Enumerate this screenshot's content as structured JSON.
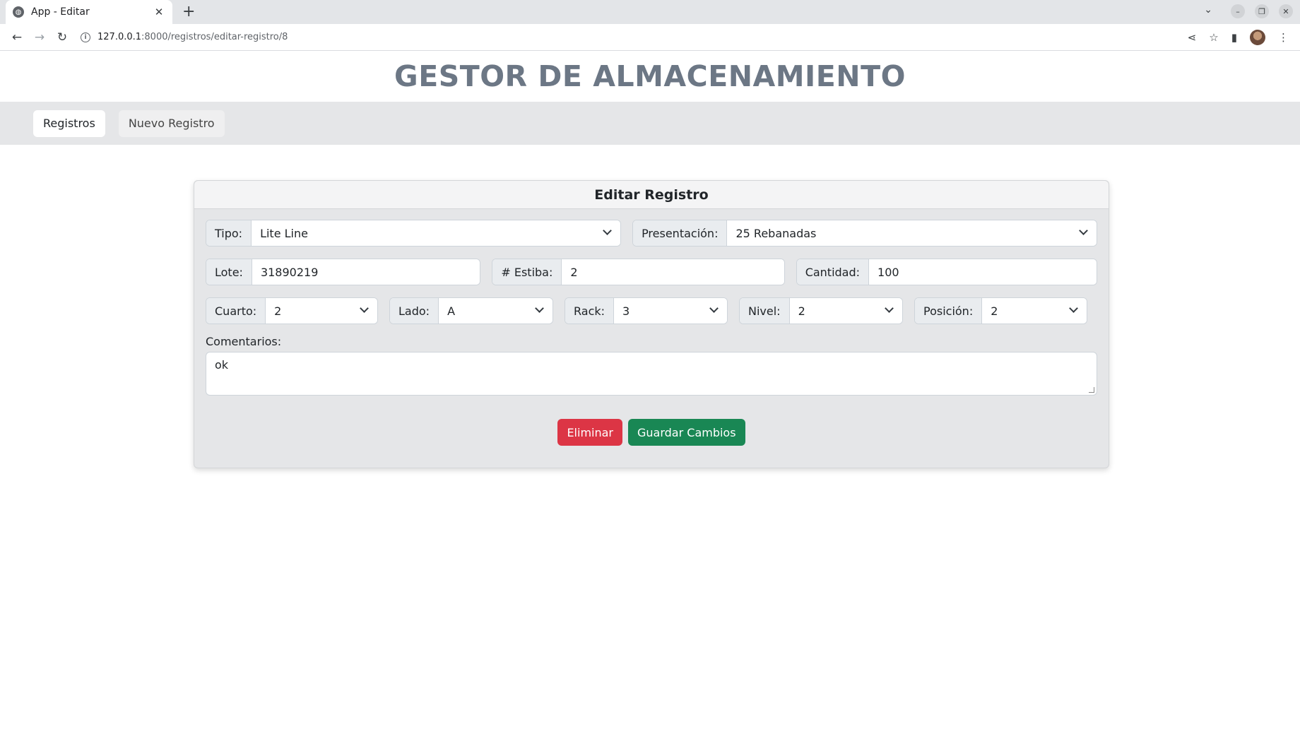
{
  "browser": {
    "tab_title": "App - Editar",
    "url_host": "127.0.0.1",
    "url_path": ":8000/registros/editar-registro/8"
  },
  "page": {
    "title": "GESTOR DE ALMACENAMIENTO",
    "nav": {
      "registros": "Registros",
      "nuevo_registro": "Nuevo Registro"
    }
  },
  "form": {
    "heading": "Editar Registro",
    "tipo": {
      "label": "Tipo:",
      "value": "Lite Line"
    },
    "presentacion": {
      "label": "Presentación:",
      "value": "25 Rebanadas"
    },
    "lote": {
      "label": "Lote:",
      "value": "31890219"
    },
    "estiba": {
      "label": "# Estiba:",
      "value": "2"
    },
    "cantidad": {
      "label": "Cantidad:",
      "value": "100"
    },
    "cuarto": {
      "label": "Cuarto:",
      "value": "2"
    },
    "lado": {
      "label": "Lado:",
      "value": "A"
    },
    "rack": {
      "label": "Rack:",
      "value": "3"
    },
    "nivel": {
      "label": "Nivel:",
      "value": "2"
    },
    "posicion": {
      "label": "Posición:",
      "value": "2"
    },
    "comentarios": {
      "label": "Comentarios:",
      "value": "ok"
    },
    "delete_label": "Eliminar",
    "save_label": "Guardar Cambios"
  },
  "colors": {
    "danger": "#dc3545",
    "success": "#198754",
    "title": "#6c7785"
  }
}
